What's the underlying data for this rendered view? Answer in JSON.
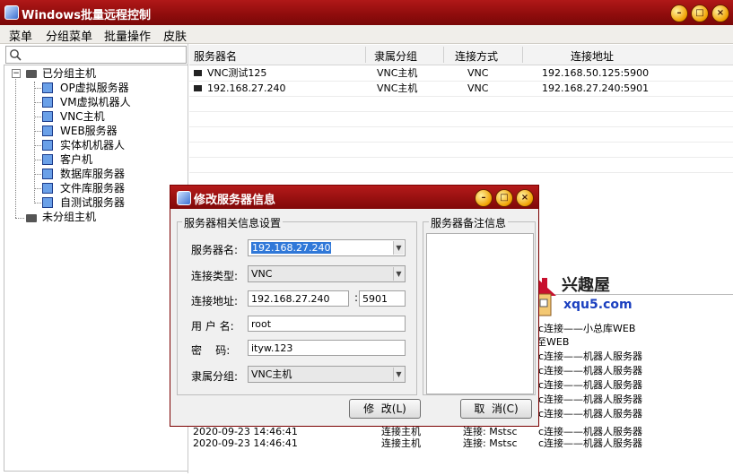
{
  "window": {
    "title": "Windows批量远程控制",
    "controls": {
      "minimize": "–",
      "maximize": "□",
      "close": "×"
    }
  },
  "menu": [
    "菜单",
    "分组菜单",
    "批量操作",
    "皮肤"
  ],
  "search": {
    "placeholder": "",
    "value": ""
  },
  "tree": {
    "root_grouped": "已分组主机",
    "groups": [
      "OP虚拟服务器",
      "VM虚拟机器人",
      "VNC主机",
      "WEB服务器",
      "实体机机器人",
      "客户机",
      "数据库服务器",
      "文件库服务器",
      "自测试服务器"
    ],
    "root_ungrouped": "未分组主机",
    "expander_grouped": "−",
    "expander_ungrouped": "+"
  },
  "list": {
    "columns": [
      "服务器名",
      "隶属分组",
      "连接方式",
      "连接地址"
    ],
    "rows": [
      {
        "name": "VNC测试125",
        "group": "VNC主机",
        "method": "VNC",
        "address": "192.168.50.125:5900"
      },
      {
        "name": "192.168.27.240",
        "group": "VNC主机",
        "method": "VNC",
        "address": "192.168.27.240:5901"
      }
    ],
    "background_rows": [
      {
        "time": "2020-09-23 14:46:41",
        "group": "连接主机",
        "method": "连接: Mstsc",
        "desc": "c连接——机器人服务器"
      },
      {
        "time": "2020-09-23 14:46:41",
        "group": "连接主机",
        "method": "连接: Mstsc",
        "desc": "c连接——机器人服务器"
      }
    ],
    "log_fragments": [
      "c连接——小总库WEB",
      "至WEB",
      "c连接——机器人服务器",
      "c连接——机器人服务器",
      "c连接——机器人服务器",
      "c连接——机器人服务器",
      "c连接——机器人服务器"
    ]
  },
  "dialog": {
    "title": "修改服务器信息",
    "group_settings": "服务器相关信息设置",
    "group_notes": "服务器备注信息",
    "labels": {
      "server_name": "服务器名:",
      "conn_type": "连接类型:",
      "address": "连接地址:",
      "username": "用 户 名:",
      "password": "密    码:",
      "group": "隶属分组:"
    },
    "values": {
      "server_name": "192.168.27.240",
      "conn_type": "VNC",
      "address": "192.168.27.240",
      "port_sep": ":",
      "port": "5901",
      "username": "root",
      "password": "ityw.123",
      "group": "VNC主机"
    },
    "buttons": {
      "ok": "修  改(L)",
      "cancel": "取  消(C)"
    },
    "controls": {
      "minimize": "–",
      "maximize": "□",
      "close": "×"
    }
  },
  "watermark": {
    "title": "兴趣屋",
    "url": "xqu5.com"
  }
}
